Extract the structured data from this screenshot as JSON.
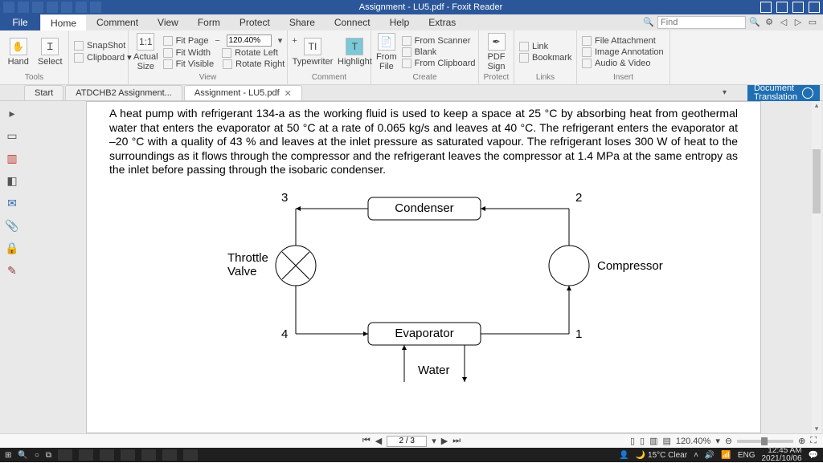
{
  "title": "Assignment - LU5.pdf - Foxit Reader",
  "ribbon_tabs": {
    "file": "File",
    "home": "Home",
    "comment": "Comment",
    "view": "View",
    "form": "Form",
    "protect": "Protect",
    "share": "Share",
    "connect": "Connect",
    "help": "Help",
    "extras": "Extras"
  },
  "find": {
    "placeholder": "Find"
  },
  "tools": {
    "group_tools": "Tools",
    "hand": "Hand",
    "select": "Select",
    "snapshot": "SnapShot",
    "clipboard": "Clipboard ▾",
    "group_view": "View",
    "actual_size": "Actual\nSize",
    "fit_page": "Fit Page",
    "fit_width": "Fit Width",
    "fit_visible": "Fit Visible",
    "zoom": "120.40%",
    "rotate_left": "Rotate Left",
    "rotate_right": "Rotate Right",
    "group_comment": "Comment",
    "typewriter": "Typewriter",
    "highlight": "Highlight",
    "group_create": "Create",
    "from_file": "From\nFile",
    "from_scanner": "From Scanner",
    "blank": "Blank",
    "from_clipboard": "From Clipboard",
    "group_protect": "Protect",
    "pdf_sign": "PDF\nSign",
    "group_links": "Links",
    "link": "Link",
    "bookmark": "Bookmark",
    "group_insert": "Insert",
    "file_attachment": "File Attachment",
    "image_annotation": "Image Annotation",
    "audio_video": "Audio & Video"
  },
  "doctabs": {
    "start": "Start",
    "atd": "ATDCHB2 Assignment...",
    "cur": "Assignment - LU5.pdf"
  },
  "doc_translation": "Document\nTranslation",
  "problem_text": "A heat pump with refrigerant 134-a as the working fluid is used to keep a space at 25 °C by absorbing heat from geothermal water that enters the evaporator at 50 °C at a rate of 0.065 kg/s and leaves at 40 °C. The refrigerant enters the evaporator at –20 °C with a quality of 43 % and leaves at the inlet pressure as saturated vapour. The refrigerant loses 300 W of heat to the surroundings as it flows through the compressor and the refrigerant leaves the compressor at 1.4 MPa at the same entropy as the inlet before passing through the isobaric condenser.",
  "diagram": {
    "condenser": "Condenser",
    "evaporator": "Evaporator",
    "throttle": "Throttle\nValve",
    "compressor": "Compressor",
    "water": "Water",
    "n1": "1",
    "n2": "2",
    "n3": "3",
    "n4": "4"
  },
  "pagenav": {
    "page": "2 / 3",
    "zoom": "120.40%"
  },
  "tray": {
    "weather": "15°C Clear",
    "lang": "ENG",
    "time": "12:45 AM",
    "date": "2021/10/06"
  }
}
